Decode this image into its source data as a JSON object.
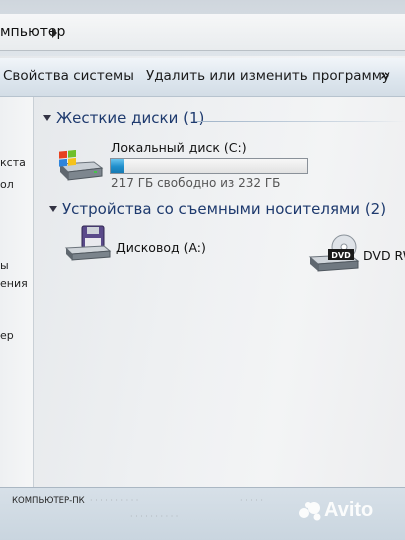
{
  "address_bar": {
    "path_text": "мпьютер"
  },
  "toolbar": {
    "system_properties": "Свойства системы",
    "uninstall": "Удалить или изменить программу",
    "more": "»"
  },
  "nav": {
    "items": [
      "кста",
      "ол",
      "ы",
      "ения",
      "ер"
    ]
  },
  "hard_drives": {
    "header": "Жесткие диски (1)",
    "items": [
      {
        "name": "Локальный диск (C:)",
        "free_text": "217 ГБ свободно из 232 ГБ",
        "used_fraction": 0.065,
        "icon": "windows-drive-icon"
      }
    ]
  },
  "removable": {
    "header": "Устройства со съемными носителями (2)",
    "items": [
      {
        "name": "Дисковод (A:)",
        "icon": "floppy-drive-icon"
      },
      {
        "name": "DVD RW",
        "icon": "dvd-drive-icon",
        "badge": "DVD"
      }
    ]
  },
  "status_bar": {
    "computer_name": "КОМПЬЮТЕР-ПК"
  },
  "watermark": {
    "text": "Avito"
  },
  "colors": {
    "progress": "#1f8ecb",
    "header_text": "#1e3a6e"
  }
}
